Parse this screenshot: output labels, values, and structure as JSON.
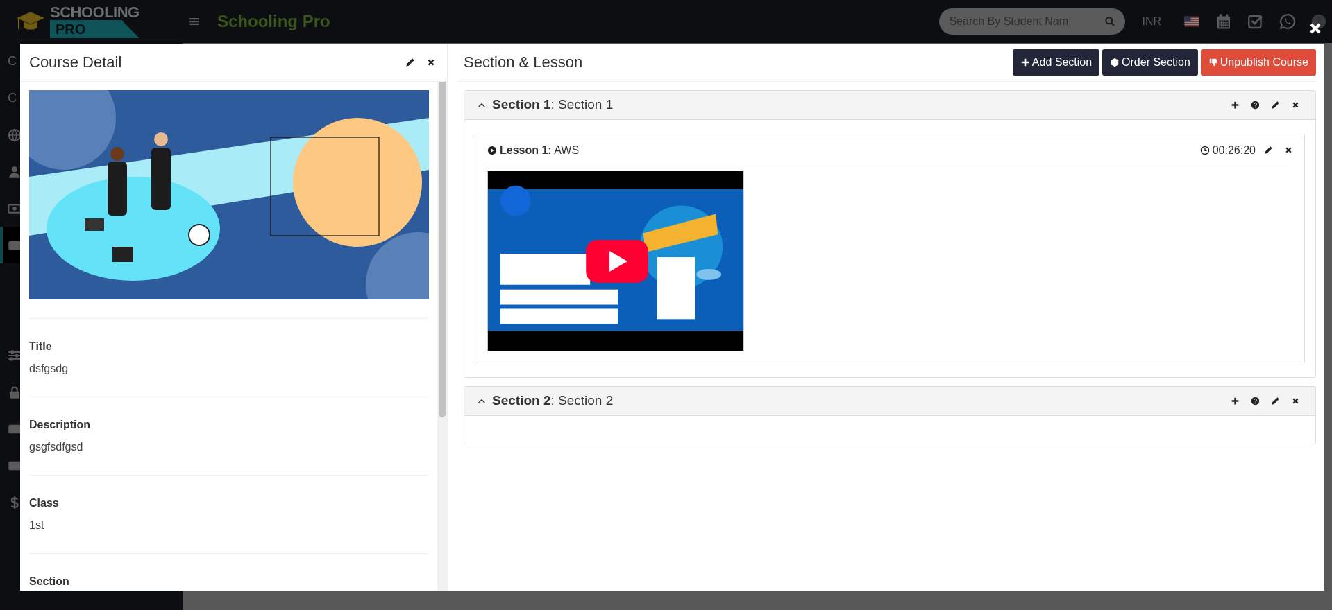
{
  "header": {
    "logo": {
      "line1": "SCHOOLING",
      "line2": "PRO"
    },
    "app_title": "Schooling Pro",
    "search": {
      "placeholder": "Search By Student Nam"
    },
    "currency": "INR"
  },
  "sidebar": {
    "items": [
      {
        "kind": "text",
        "label": "C",
        "selected": false
      },
      {
        "kind": "text",
        "label": "C",
        "selected": false
      },
      {
        "kind": "globe",
        "selected": false
      },
      {
        "kind": "user",
        "selected": false
      },
      {
        "kind": "money",
        "selected": false
      },
      {
        "kind": "card",
        "selected": true
      },
      {
        "kind": "blank",
        "selected": false
      },
      {
        "kind": "blank",
        "selected": false
      },
      {
        "kind": "sliders",
        "selected": false
      },
      {
        "kind": "lock",
        "selected": false
      },
      {
        "kind": "card",
        "selected": false
      },
      {
        "kind": "card",
        "selected": false
      },
      {
        "kind": "dollar",
        "selected": false
      }
    ]
  },
  "course_detail": {
    "title": "Course Detail",
    "fields": [
      {
        "label": "Title",
        "value": "dsfgsdg"
      },
      {
        "label": "Description",
        "value": "gsgfsdfgsd"
      },
      {
        "label": "Class",
        "value": "1st"
      },
      {
        "label": "Section"
      }
    ]
  },
  "sections_panel": {
    "title": "Section & Lesson",
    "buttons": [
      {
        "label": "Add Section",
        "kind": "add"
      },
      {
        "label": "Order Section",
        "kind": "order"
      },
      {
        "label": "Unpublish Course",
        "kind": "unpublish"
      }
    ],
    "sections": [
      {
        "heading": "**Section 1**: Section 1",
        "expanded": true,
        "lessons": [
          {
            "heading": "**Lesson 1:** AWS",
            "duration": "00:26:20"
          }
        ]
      },
      {
        "heading": "**Section 2**: Section 2",
        "expanded": true
      }
    ]
  }
}
